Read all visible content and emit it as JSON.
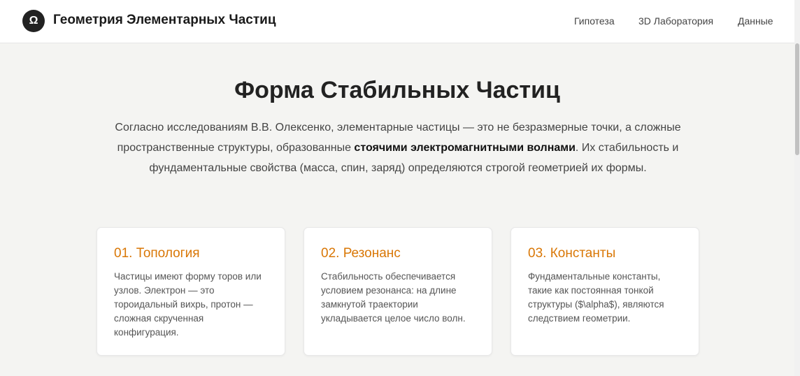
{
  "header": {
    "logo_glyph": "Ω",
    "title": "Геометрия Элементарных Частиц",
    "nav": [
      "Гипотеза",
      "3D Лаборатория",
      "Данные"
    ]
  },
  "hero": {
    "title": "Форма Стабильных Частиц",
    "lead_before": "Согласно исследованиям В.В. Олексенко, элементарные частицы — это не безразмерные точки, а сложные пространственные структуры, образованные ",
    "lead_bold": "стоячими электромагнитными волнами",
    "lead_after": ". Их стабильность и фундаментальные свойства (масса, спин, заряд) определяются строгой геометрией их формы."
  },
  "cards": [
    {
      "title": "01. Топология",
      "text": "Частицы имеют форму торов или узлов. Электрон — это тороидальный вихрь, протон — сложная скрученная конфигурация."
    },
    {
      "title": "02. Резонанс",
      "text": "Стабильность обеспечивается условием резонанса: на длине замкнутой траектории укладывается целое число волн."
    },
    {
      "title": "03. Константы",
      "text": "Фундаментальные константы, такие как постоянная тонкой структуры ($\\alpha$), являются следствием геометрии."
    }
  ],
  "colors": {
    "accent": "#d97706",
    "background": "#f4f4f2"
  }
}
